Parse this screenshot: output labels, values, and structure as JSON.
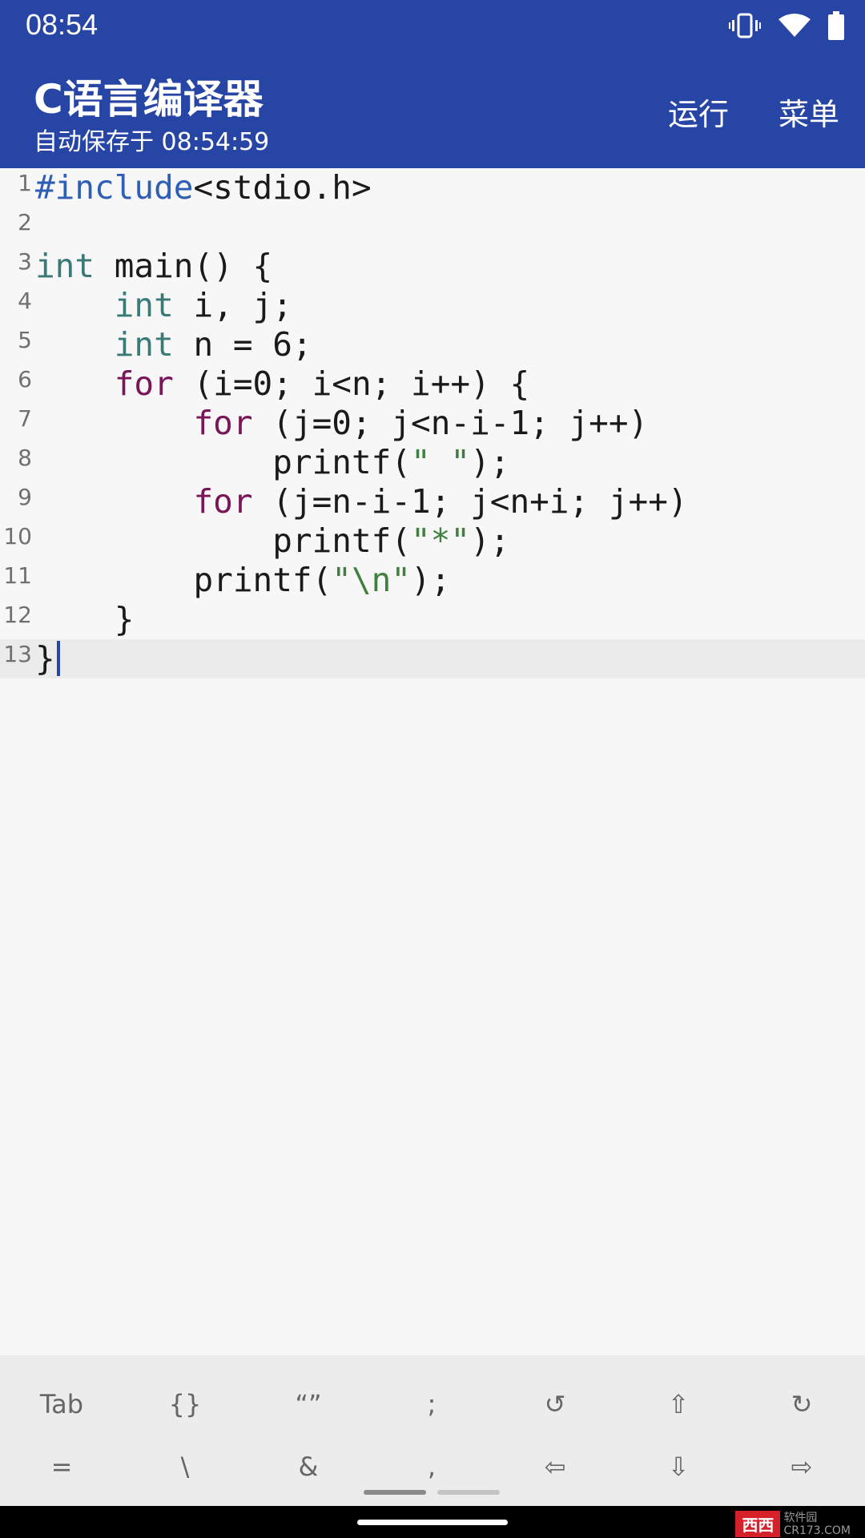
{
  "status": {
    "time": "08:54"
  },
  "app": {
    "title": "C语言编译器",
    "subtitle": "自动保存于 08:54:59",
    "actions": {
      "run": "运行",
      "menu": "菜单"
    }
  },
  "editor": {
    "lines": [
      {
        "n": "1",
        "code": "#include<stdio.h>"
      },
      {
        "n": "2",
        "code": ""
      },
      {
        "n": "3",
        "code": "int main() {"
      },
      {
        "n": "4",
        "code": "    int i, j;"
      },
      {
        "n": "5",
        "code": "    int n = 6;"
      },
      {
        "n": "6",
        "code": "    for (i=0; i<n; i++) {"
      },
      {
        "n": "7",
        "code": "        for (j=0; j<n-i-1; j++)"
      },
      {
        "n": "8",
        "code": "            printf(\" \");"
      },
      {
        "n": "9",
        "code": "        for (j=n-i-1; j<n+i; j++)"
      },
      {
        "n": "10",
        "code": "            printf(\"*\");"
      },
      {
        "n": "11",
        "code": "        printf(\"\\n\");"
      },
      {
        "n": "12",
        "code": "    }"
      },
      {
        "n": "13",
        "code": "}"
      }
    ],
    "current_line": 13
  },
  "keybar": {
    "row1": [
      "Tab",
      "{}",
      "“”",
      ";",
      "↺",
      "⇧",
      "↻"
    ],
    "row2": [
      "=",
      "\\",
      "&",
      ",",
      "⇦",
      "⇩",
      "⇨"
    ]
  },
  "watermark": {
    "badge": "西西",
    "text1": "软件园",
    "text2": "CR173.COM"
  },
  "colors": {
    "primary": "#2745a4",
    "keyword_type": "#3a7a76",
    "keyword_control": "#7a1658",
    "preprocessor": "#2f5fb4",
    "string": "#3f7f3f"
  }
}
